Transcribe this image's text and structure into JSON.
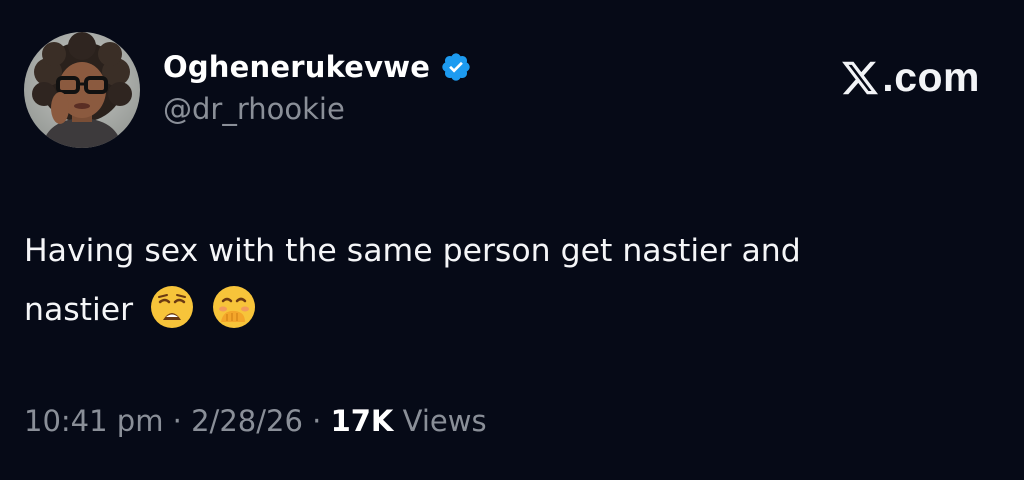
{
  "author": {
    "display_name": "Oghenerukevwe",
    "handle": "@dr_rhookie",
    "verified": true,
    "avatar": "profile-photo"
  },
  "brand": {
    "text": ".com",
    "icon": "x-logo-icon"
  },
  "tweet": {
    "text_line1": "Having sex with the same person get nastier and",
    "text_line2": "nastier",
    "emojis": [
      "weary-face-emoji",
      "face-with-hand-over-mouth-emoji"
    ]
  },
  "meta": {
    "time": "10:41 pm",
    "separator": "·",
    "date": "2/28/26",
    "views_count": "17K",
    "views_label": "Views"
  },
  "colors": {
    "background": "#060a17",
    "text": "#f2f4f7",
    "muted": "#8a8f98",
    "verified_blue": "#1d9bf0"
  }
}
